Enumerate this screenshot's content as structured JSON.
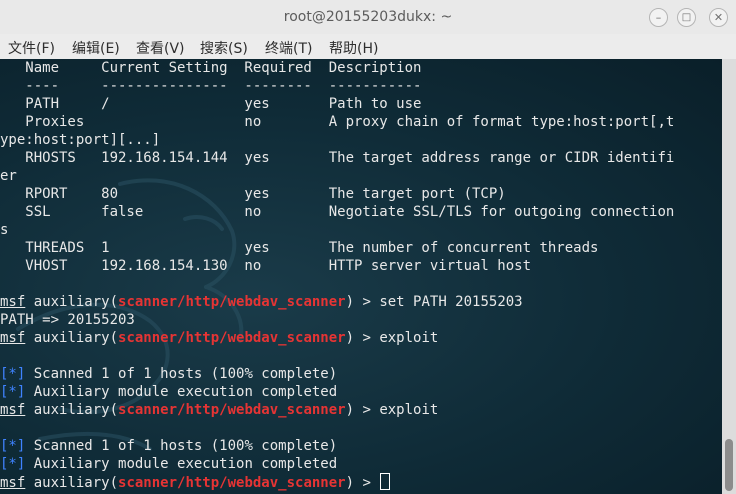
{
  "window": {
    "title": "root@20155203dukx: ~"
  },
  "controls": {
    "minimize": "–",
    "maximize": "□",
    "close": "✕"
  },
  "menu": [
    "文件(F)",
    "编辑(E)",
    "查看(V)",
    "搜索(S)",
    "终端(T)",
    "帮助(H)"
  ],
  "terminal": {
    "options_header": "   Name     Current Setting  Required  Description",
    "options_rule": "   ----     ---------------  --------  -----------",
    "options_lines": [
      "   PATH     /                yes       Path to use",
      "   Proxies                   no        A proxy chain of format type:host:port[,t",
      "ype:host:port][...]",
      "   RHOSTS   192.168.154.144  yes       The target address range or CIDR identifi",
      "er",
      "   RPORT    80               yes       The target port (TCP)",
      "   SSL      false            no        Negotiate SSL/TLS for outgoing connection",
      "s",
      "   THREADS  1                yes       The number of concurrent threads",
      "   VHOST    192.168.154.130  no        HTTP server virtual host"
    ],
    "prompt_msf": "msf",
    "prompt_mid": " auxiliary(",
    "module": "scanner/http/webdav_scanner",
    "prompt_end": ") > ",
    "cmd_set": "set PATH 20155203",
    "set_result": "PATH => 20155203",
    "cmd_exploit": "exploit",
    "status_tag": "[*]",
    "scan_msg": " Scanned 1 of 1 hosts (100% complete)",
    "done_msg": " Auxiliary module execution completed"
  },
  "colors": {
    "terminal_bg": "#0f2a35",
    "module_red": "#e63434",
    "status_blue": "#3f83ff",
    "text": "#e8e8e8"
  }
}
